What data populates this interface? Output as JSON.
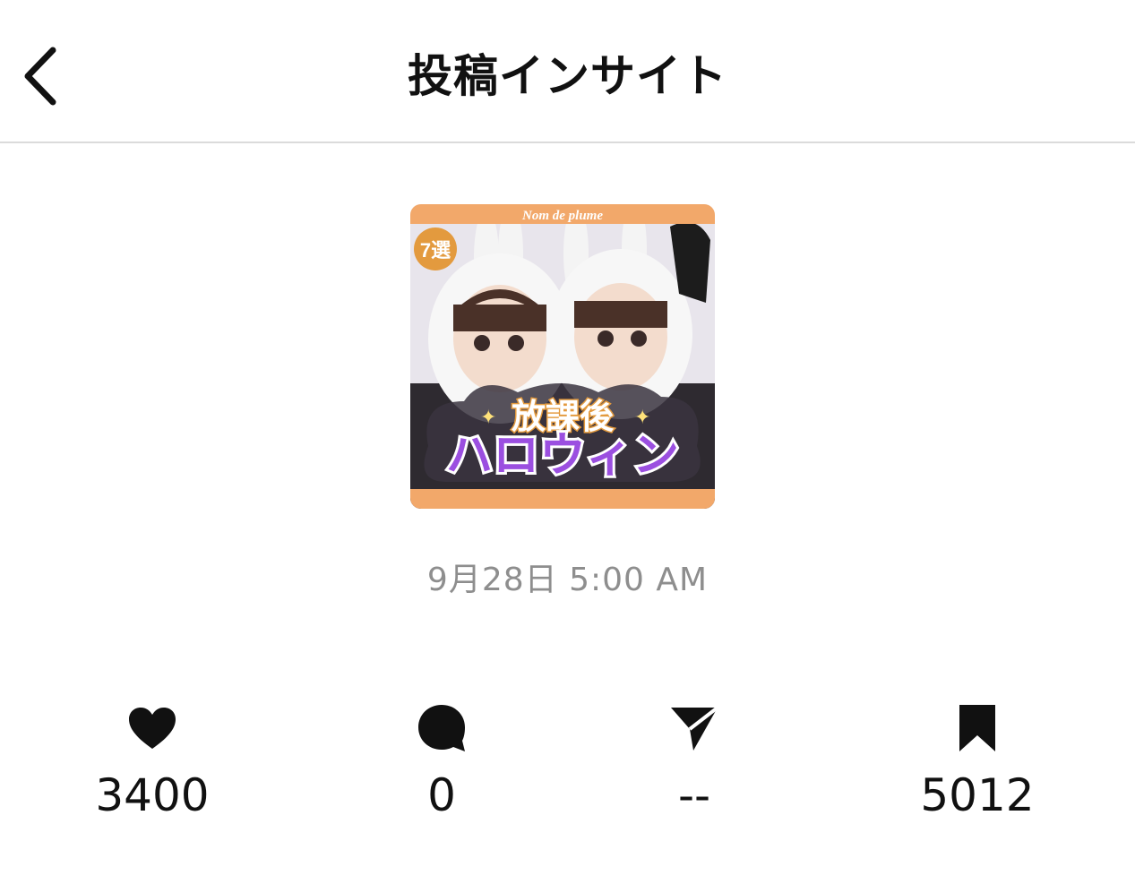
{
  "header": {
    "title": "投稿インサイト",
    "back_icon": "chevron-left-icon"
  },
  "post": {
    "thumbnail": {
      "brand_text": "Nom de plume",
      "badge_text": "7選",
      "headline_top": "放課後",
      "headline_bottom": "ハロウィン",
      "accent_color": "#f2a86a",
      "headline_color": "#9b4fe0"
    },
    "timestamp": "9月28日 5:00 AM"
  },
  "metrics": [
    {
      "icon": "heart-icon",
      "value": "3400"
    },
    {
      "icon": "comment-icon",
      "value": "0"
    },
    {
      "icon": "share-icon",
      "value": "--"
    },
    {
      "icon": "bookmark-icon",
      "value": "5012"
    }
  ],
  "colors": {
    "text": "#111111",
    "muted": "#8e8e8e",
    "divider": "#dbdbdb"
  }
}
